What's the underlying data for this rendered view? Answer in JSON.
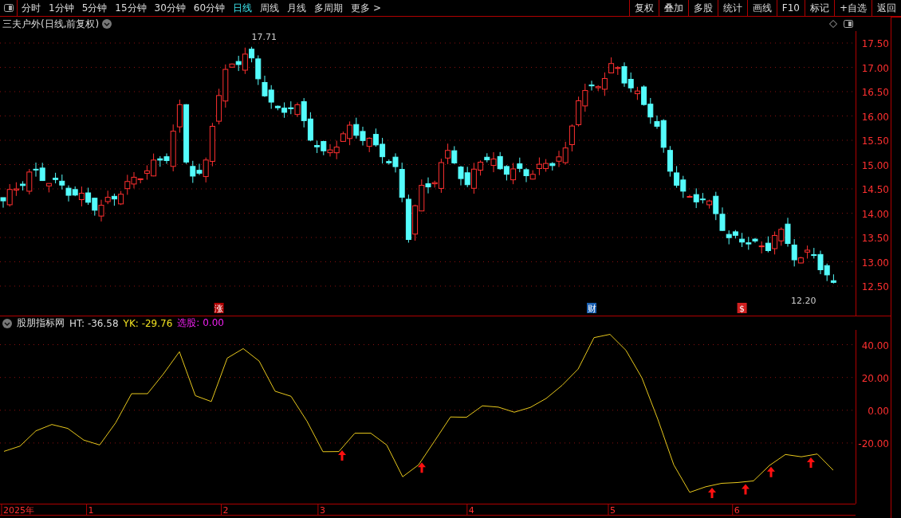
{
  "toolbar": {
    "periods": [
      {
        "label": "分时",
        "selected": false
      },
      {
        "label": "1分钟",
        "selected": false
      },
      {
        "label": "5分钟",
        "selected": false
      },
      {
        "label": "15分钟",
        "selected": false
      },
      {
        "label": "30分钟",
        "selected": false
      },
      {
        "label": "60分钟",
        "selected": false
      },
      {
        "label": "日线",
        "selected": true
      },
      {
        "label": "周线",
        "selected": false
      },
      {
        "label": "月线",
        "selected": false
      },
      {
        "label": "多周期",
        "selected": false
      }
    ],
    "more": "更多 >",
    "buttons": [
      "复权",
      "叠加",
      "多股",
      "统计",
      "画线",
      "F10",
      "标记",
      "+自选",
      "返回"
    ]
  },
  "price_chart": {
    "title": "三夫户外(日线,前复权)",
    "yticks": [
      "17.50",
      "17.00",
      "16.50",
      "16.00",
      "15.50",
      "15.00",
      "14.50",
      "14.00",
      "13.50",
      "13.00",
      "12.50"
    ],
    "high_label": "17.71",
    "low_label": "12.20",
    "markers": [
      {
        "text": "涨",
        "color": "#b00000"
      },
      {
        "text": "财",
        "color": "#1a5fb0"
      },
      {
        "text": "$",
        "color": "#d02020"
      }
    ]
  },
  "indicator": {
    "name": "股朋指标网",
    "readings": [
      {
        "kind": "ht",
        "text": "HT: -36.58"
      },
      {
        "kind": "yk",
        "text": "YK: -29.76"
      },
      {
        "kind": "pick",
        "text": "选股: 0.00"
      }
    ],
    "chart_data": {
      "type": "line",
      "ylim": [
        -57,
        49
      ],
      "grid": true,
      "yticks": [
        {
          "value": 40,
          "label": "40.00"
        },
        {
          "value": 20,
          "label": "20.00"
        },
        {
          "value": 0,
          "label": "0.00"
        },
        {
          "value": -20,
          "label": "-20.00"
        }
      ],
      "categories": [
        null,
        null,
        null,
        null,
        null,
        null,
        null,
        null,
        null,
        null,
        null,
        null,
        null,
        null,
        null,
        null,
        null,
        null,
        null,
        null,
        null,
        null,
        null,
        null,
        null,
        null,
        null,
        null,
        null,
        null,
        null,
        null,
        null,
        null,
        null,
        null,
        null,
        null,
        null,
        null,
        null,
        null,
        null,
        null,
        null,
        null,
        null,
        null,
        null,
        null,
        null,
        null,
        null
      ],
      "series": [
        {
          "color": "#e8c81c",
          "values": [
            -25.1,
            -21.9,
            -12.6,
            -8.7,
            -11.1,
            -18.2,
            -21.2,
            -7.7,
            10.1,
            10.1,
            22.2,
            35.7,
            8.9,
            5.3,
            31.8,
            37.6,
            30.0,
            11.6,
            8.5,
            -6.7,
            -25.3,
            -25.2,
            -14.0,
            -14.0,
            -21.2,
            -40.6,
            -33.3,
            -18.8,
            -4.1,
            -4.3,
            2.7,
            1.9,
            -1.2,
            1.7,
            7.2,
            15.2,
            25.1,
            44.3,
            46.3,
            36.6,
            19.8,
            -5.5,
            -33.3,
            -50.1,
            -46.7,
            -44.6,
            -44.1,
            -43.1,
            -33.7,
            -27.0,
            -28.4,
            -26.7,
            -36.6
          ]
        }
      ]
    }
  },
  "time_axis": [
    {
      "label": "2025年"
    },
    {
      "label": "1"
    },
    {
      "label": "2"
    },
    {
      "label": "3"
    },
    {
      "label": "4"
    },
    {
      "label": "5"
    },
    {
      "label": "6"
    }
  ]
}
